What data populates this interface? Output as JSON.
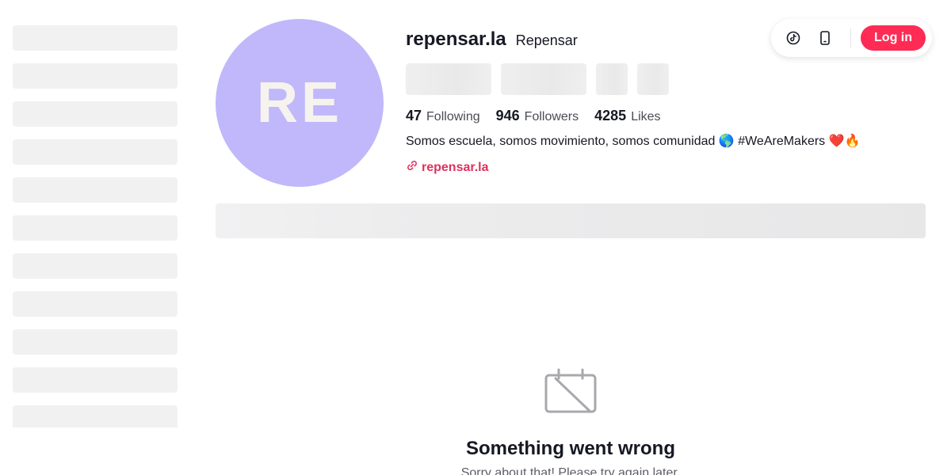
{
  "header": {
    "login_label": "Log in",
    "accent_color": "#fe2c55"
  },
  "profile": {
    "avatar_initials": "RE",
    "username": "repensar.la",
    "nickname": "Repensar",
    "stats": {
      "following_count": "47",
      "following_label": "Following",
      "followers_count": "946",
      "followers_label": "Followers",
      "likes_count": "4285",
      "likes_label": "Likes"
    },
    "bio": "Somos escuela, somos movimiento, somos comunidad 🌎 #WeAreMakers ❤️🔥",
    "link_text": "repensar.la"
  },
  "error": {
    "title": "Something went wrong",
    "message": "Sorry about that! Please try again later."
  },
  "icons": {
    "top_left": "tiktok-icon",
    "top_right": "mobile-phone-icon",
    "link": "link-icon",
    "error": "no-content-icon"
  }
}
